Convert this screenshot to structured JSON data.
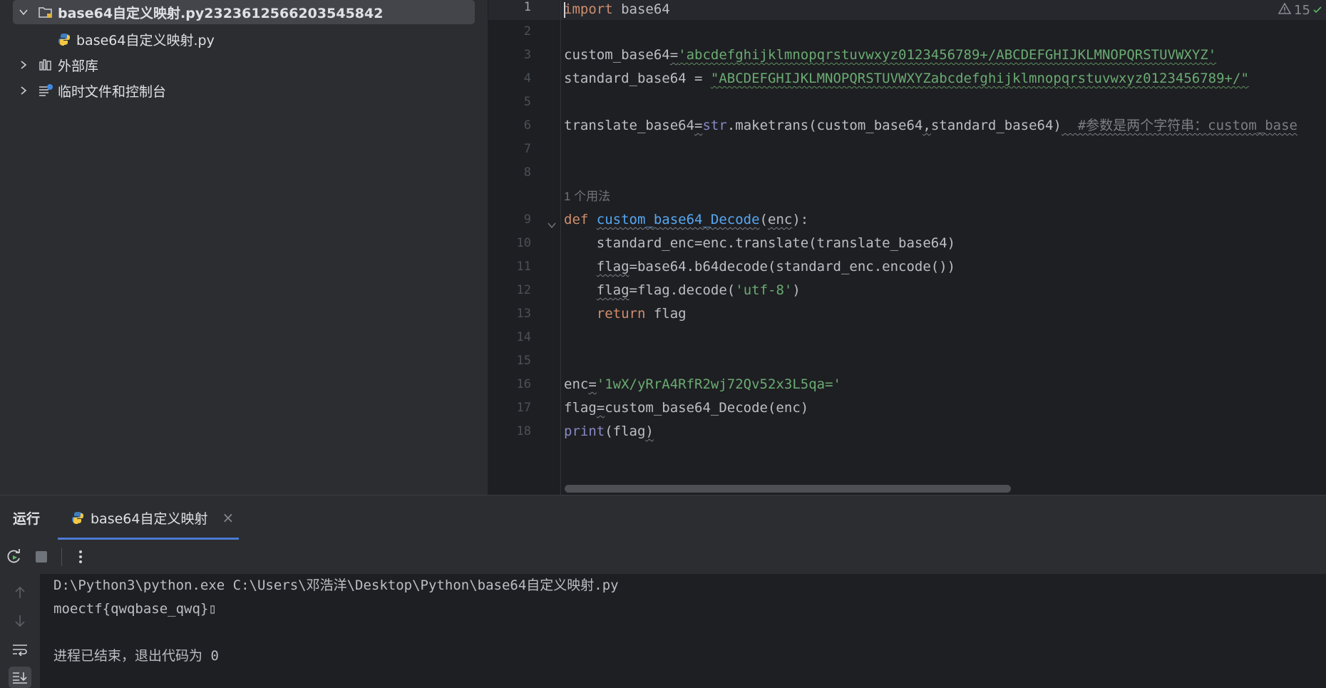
{
  "project_tree": {
    "root_label": "base64自定义映射.py2323612566203545842",
    "file_label": "base64自定义映射.py",
    "external_libs_label": "外部库",
    "scratches_label": "临时文件和控制台"
  },
  "editor": {
    "problems_count": "15",
    "line_numbers": [
      "1",
      "2",
      "3",
      "4",
      "5",
      "6",
      "7",
      "8",
      "9",
      "10",
      "11",
      "12",
      "13",
      "14",
      "15",
      "16",
      "17",
      "18"
    ],
    "usage_hint": "1 个用法",
    "lines": {
      "l1": {
        "kw": "import",
        "rest": " base64"
      },
      "l3": {
        "var": "custom_base64",
        "eq": "=",
        "str": "'abcdefghijklmnopqrstuvwxyz0123456789+/ABCDEFGHIJKLMNOPQRSTUVWXYZ'"
      },
      "l4": {
        "var": "standard_base64 = ",
        "str": "\"ABCDEFGHIJKLMNOPQRSTUVWXYZabcdefghijklmnopqrstuvwxyz0123456789+/\""
      },
      "l6": {
        "var": "translate_base64",
        "eq": "=",
        "builtin": "str",
        "call": ".maketrans(custom_base64",
        "comma": ",",
        "args": "standard_base64)",
        "comment": "  #参数是两个字符串：custom_base"
      },
      "l9": {
        "kw": "def ",
        "fn": "custom_base64_Decode",
        "paren": "(",
        "param": "enc",
        "close": "):"
      },
      "l10": {
        "indent": "    ",
        "text": "standard_enc=enc.translate(translate_base64)"
      },
      "l11": {
        "indent": "    ",
        "var": "flag",
        "text": "=base64.b64decode(standard_enc.encode())"
      },
      "l12": {
        "indent": "    ",
        "var": "flag",
        "text": "=flag.decode(",
        "str": "'utf-8'",
        "close": ")"
      },
      "l13": {
        "indent": "    ",
        "kw": "return",
        "text": " flag"
      },
      "l16": {
        "var": "enc",
        "eq": "=",
        "str": "'1wX/yRrA4RfR2wj72Qv52x3L5qa='"
      },
      "l17": {
        "var": "flag",
        "eq": "=",
        "text": "custom_base64_Decode(enc)"
      },
      "l18": {
        "builtin": "print",
        "text": "(flag",
        ",close": ")",
        "close": ")"
      }
    }
  },
  "run_panel": {
    "title": "运行",
    "tab_label": "base64自定义映射",
    "tab_close": "×",
    "console": {
      "command": "D:\\Python3\\python.exe C:\\Users\\邓浩洋\\Desktop\\Python\\base64自定义映射.py",
      "output": "moectf{qwqbase_qwq}▯",
      "exit_message": "进程已结束，退出代码为 0"
    }
  },
  "colors": {
    "keyword": "#cf8e6d",
    "string": "#6aab73",
    "function": "#56a8f5",
    "builtin": "#8888c6",
    "comment": "#7a7e85",
    "accent": "#4b7ad4"
  }
}
